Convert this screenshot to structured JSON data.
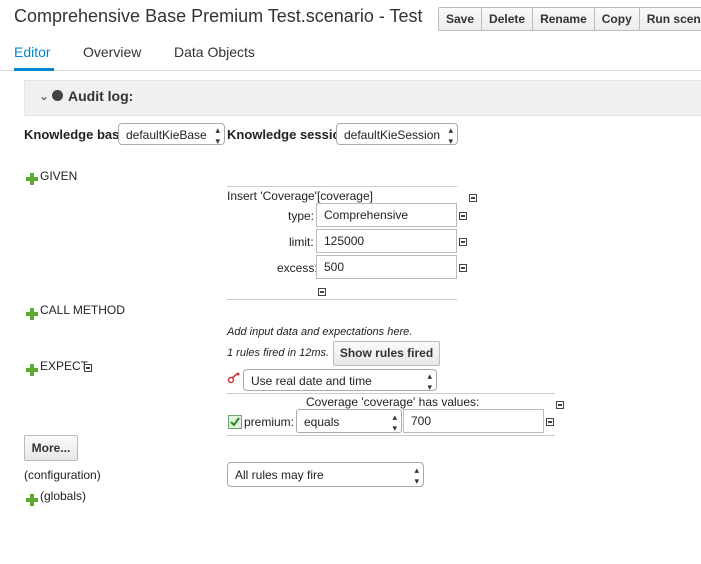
{
  "header": {
    "title": "Comprehensive Base Premium Test.scenario - Test Sc...",
    "buttons": [
      "Save",
      "Delete",
      "Rename",
      "Copy",
      "Run scenario"
    ]
  },
  "tabs": [
    "Editor",
    "Overview",
    "Data Objects"
  ],
  "audit": {
    "chevron": "⌄",
    "label": "Audit log:"
  },
  "knowledge": {
    "base_label": "Knowledge base",
    "base_value": "defaultKieBase",
    "session_label": "Knowledge session",
    "session_value": "defaultKieSession"
  },
  "given": {
    "label": "GIVEN",
    "insert_title": "Insert 'Coverage'[coverage]",
    "fields": [
      {
        "name": "type:",
        "value": "Comprehensive"
      },
      {
        "name": "limit:",
        "value": "125000"
      },
      {
        "name": "excess:",
        "value": "500"
      }
    ]
  },
  "call_method": {
    "label": "CALL METHOD"
  },
  "expect": {
    "label": "EXPECT",
    "hint": "Add input data and expectations here.",
    "fired_text": "1 rules fired in 12ms.",
    "show_button": "Show rules fired",
    "date_option": "Use real date and time",
    "coverage_title": "Coverage 'coverage' has values:",
    "field_name": "premium:",
    "operator": "equals",
    "expected_value": "700"
  },
  "more_button": "More...",
  "configuration": {
    "label": "(configuration)",
    "value": "All rules may fire"
  },
  "globals_label": "(globals)",
  "colors": {
    "accent": "#0088ce",
    "plus_green": "#5aab32"
  }
}
